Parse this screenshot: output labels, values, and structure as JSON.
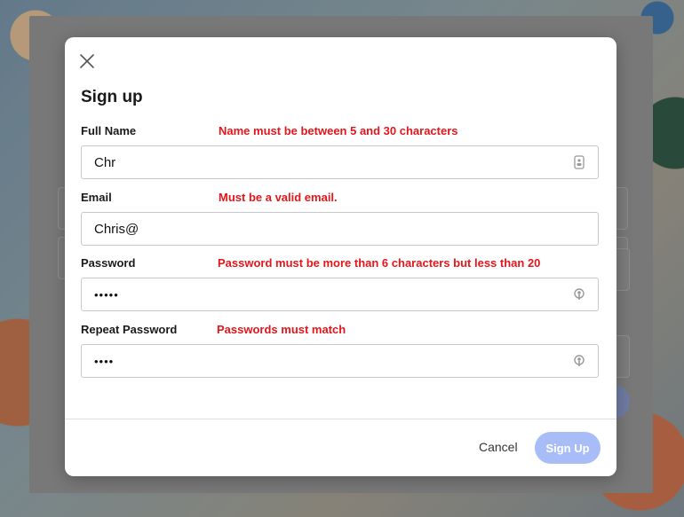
{
  "modal": {
    "title": "Sign up",
    "fields": [
      {
        "label": "Full Name",
        "error": "Name must be between 5 and 30 characters",
        "value": "Chr",
        "icon": "contact-card-icon"
      },
      {
        "label": "Email",
        "error": "Must be a valid email.",
        "value": "Chris@",
        "icon": ""
      },
      {
        "label": "Password",
        "error": "Password must be more than 6 characters but less than 20",
        "value": "•••••",
        "icon": "key-icon"
      },
      {
        "label": "Repeat Password",
        "error": "Passwords must match",
        "value": "••••",
        "icon": "key-icon"
      }
    ],
    "cancel_label": "Cancel",
    "submit_label": "Sign Up"
  },
  "colors": {
    "error": "#e4161b",
    "submit_disabled": "#a8bdf7"
  }
}
